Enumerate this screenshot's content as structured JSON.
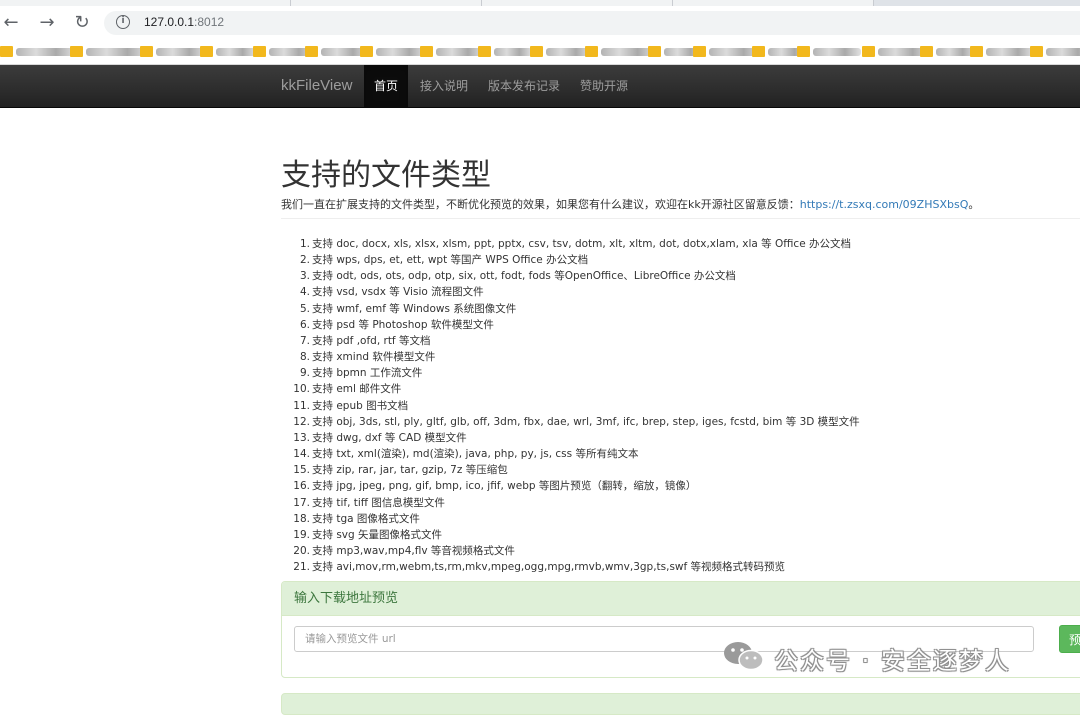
{
  "browser": {
    "url_host": "127.0.0.1",
    "url_port": ":8012",
    "back_icon": "←",
    "forward_icon": "→",
    "reload_icon": "↻",
    "info_icon": "i"
  },
  "navbar": {
    "brand": "kkFileView",
    "links": [
      "首页",
      "接入说明",
      "版本发布记录",
      "赞助开源"
    ]
  },
  "page": {
    "title": "支持的文件类型",
    "subtitle_text": "我们一直在扩展支持的文件类型，不断优化预览的效果，如果您有什么建议，欢迎在kk开源社区留意反馈：",
    "subtitle_link": "https://t.zsxq.com/09ZHSXbsQ",
    "subtitle_end": "。"
  },
  "features": [
    "支持 doc, docx, xls, xlsx, xlsm, ppt, pptx, csv, tsv, dotm, xlt, xltm, dot, dotx,xlam, xla 等 Office 办公文档",
    "支持 wps, dps, et, ett, wpt 等国产 WPS Office 办公文档",
    "支持 odt, ods, ots, odp, otp, six, ott, fodt, fods 等OpenOffice、LibreOffice 办公文档",
    "支持 vsd, vsdx 等 Visio 流程图文件",
    "支持 wmf, emf 等 Windows 系统图像文件",
    "支持 psd 等 Photoshop 软件模型文件",
    "支持 pdf ,ofd, rtf 等文档",
    "支持 xmind 软件模型文件",
    "支持 bpmn 工作流文件",
    "支持 eml 邮件文件",
    "支持 epub 图书文档",
    "支持 obj, 3ds, stl, ply, gltf, glb, off, 3dm, fbx, dae, wrl, 3mf, ifc, brep, step, iges, fcstd, bim 等 3D 模型文件",
    "支持 dwg, dxf 等 CAD 模型文件",
    "支持 txt, xml(渲染), md(渲染), java, php, py, js, css 等所有纯文本",
    "支持 zip, rar, jar, tar, gzip, 7z 等压缩包",
    "支持 jpg, jpeg, png, gif, bmp, ico, jfif, webp 等图片预览（翻转，缩放，镜像）",
    "支持 tif, tiff 图信息模型文件",
    "支持 tga 图像格式文件",
    "支持 svg 矢量图像格式文件",
    "支持 mp3,wav,mp4,flv 等音视频格式文件",
    "支持 avi,mov,rm,webm,ts,rm,mkv,mpeg,ogg,mpg,rmvb,wmv,3gp,ts,swf 等视频格式转码预览"
  ],
  "preview_panel": {
    "heading": "输入下载地址预览",
    "input_placeholder": "请输入预览文件 url",
    "button_label": "预览"
  },
  "watermark": {
    "text": "公众号 · 安全逐梦人",
    "logo_icon": "wechat-logo"
  },
  "colors": {
    "navbar_bg": "#222222",
    "link": "#337ab7",
    "panel_heading_bg": "#dff0d8",
    "panel_heading_text": "#3c763d",
    "button_green": "#5cb85c",
    "bookmark_folder": "#f2b81d"
  }
}
